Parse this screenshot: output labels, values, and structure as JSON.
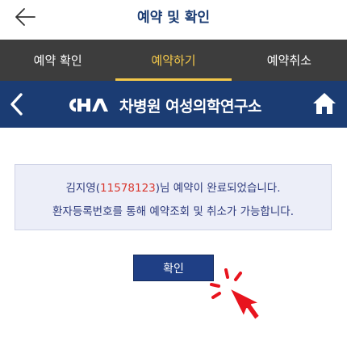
{
  "header": {
    "title": "예약 및 확인"
  },
  "tabs": [
    {
      "label": "예약 확인",
      "active": false
    },
    {
      "label": "예약하기",
      "active": true
    },
    {
      "label": "예약취소",
      "active": false
    }
  ],
  "brand": {
    "logo": "CHA",
    "text": "차병원 여성의학연구소"
  },
  "message": {
    "name": "김지영",
    "paren_open": "(",
    "patient_number": "11578123",
    "suffix": ")님 예약이 완료되었습니다.",
    "line2": "환자등록번호를 통해 예약조회 및 취소가 가능합니다."
  },
  "confirm_button": {
    "label": "확인"
  },
  "colors": {
    "navy": "#1b3c73",
    "tab_bg": "#3d3d3d",
    "tab_active": "#f3c84a",
    "highlight": "#d9372e",
    "cursor": "#e8141e"
  },
  "icons": {
    "back": "arrow-left-icon",
    "prev": "chevron-left-icon",
    "home": "home-icon",
    "cursor": "hand-pointer-icon"
  }
}
